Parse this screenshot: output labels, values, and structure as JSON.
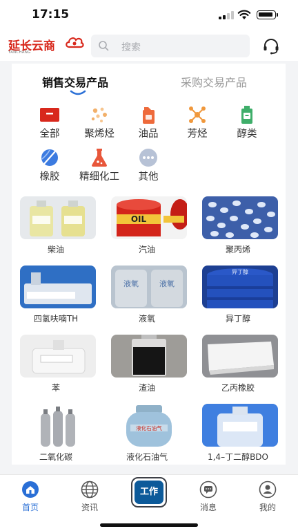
{
  "status_bar": {
    "time": "17:15"
  },
  "header": {
    "logo_text": "延长云商",
    "logo_subtext": "YANCHANG",
    "search_placeholder": "搜索"
  },
  "tabs": [
    {
      "label": "销售交易产品",
      "active": true
    },
    {
      "label": "采购交易产品",
      "active": false
    }
  ],
  "categories": [
    {
      "label": "全部",
      "icon": "all-box-icon"
    },
    {
      "label": "聚烯烃",
      "icon": "particles-icon"
    },
    {
      "label": "油品",
      "icon": "fuel-can-icon"
    },
    {
      "label": "芳烃",
      "icon": "molecule-icon"
    },
    {
      "label": "醇类",
      "icon": "bottle-icon"
    },
    {
      "label": "橡胶",
      "icon": "rubber-ball-icon"
    },
    {
      "label": "精细化工",
      "icon": "flask-icon"
    },
    {
      "label": "其他",
      "icon": "more-dots-icon"
    }
  ],
  "products": [
    {
      "name": "柴油",
      "image_text": ""
    },
    {
      "name": "汽油",
      "image_text": "OIL"
    },
    {
      "name": "聚丙烯",
      "image_text": ""
    },
    {
      "name": "四氢呋喃TH",
      "image_text": ""
    },
    {
      "name": "液氧",
      "image_text": "液氧"
    },
    {
      "name": "异丁醇",
      "image_text": "异丁醇"
    },
    {
      "name": "苯",
      "image_text": ""
    },
    {
      "name": "渣油",
      "image_text": ""
    },
    {
      "name": "乙丙橡胶",
      "image_text": ""
    },
    {
      "name": "二氧化碳",
      "image_text": ""
    },
    {
      "name": "液化石油气",
      "image_text": "液化石油气"
    },
    {
      "name": "1,4–丁二醇BDO",
      "image_text": ""
    }
  ],
  "tabbar": {
    "home": "首页",
    "news": "资讯",
    "work": "工作",
    "messages": "消息",
    "mine": "我的"
  },
  "colors": {
    "accent": "#2a6fd6",
    "brand_red": "#d8281c",
    "work_button": "#0c5a9a",
    "page_background": "#f3f4f6"
  }
}
